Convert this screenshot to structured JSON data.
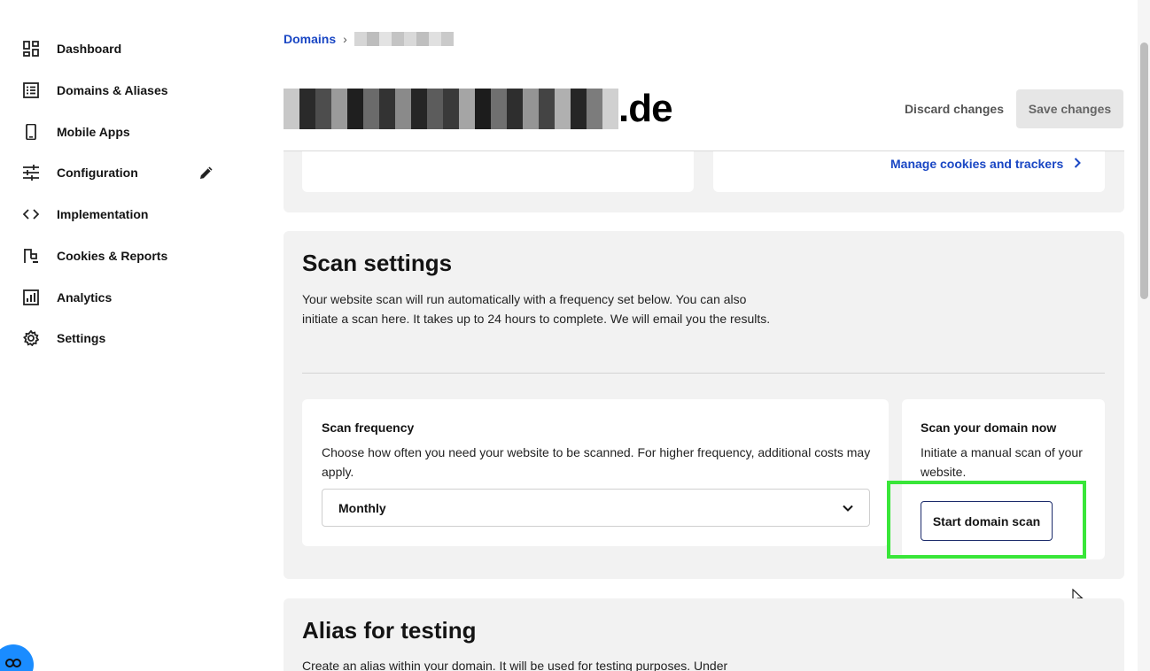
{
  "sidebar": {
    "items": [
      {
        "label": "Dashboard",
        "icon": "dashboard-icon"
      },
      {
        "label": "Domains & Aliases",
        "icon": "list-icon"
      },
      {
        "label": "Mobile Apps",
        "icon": "mobile-icon"
      },
      {
        "label": "Configuration",
        "icon": "sliders-icon"
      },
      {
        "label": "Implementation",
        "icon": "code-icon"
      },
      {
        "label": "Cookies & Reports",
        "icon": "flag-icon"
      },
      {
        "label": "Analytics",
        "icon": "chart-icon"
      },
      {
        "label": "Settings",
        "icon": "gear-icon"
      }
    ]
  },
  "breadcrumb": {
    "root": "Domains",
    "separator": "›"
  },
  "header": {
    "domain_suffix": ".de",
    "discard_label": "Discard changes",
    "save_label": "Save changes"
  },
  "cookies_section": {
    "manage_link": "Manage cookies and trackers"
  },
  "scan_settings": {
    "title": "Scan settings",
    "description": "Your website scan will run automatically with a frequency set below. You can also initiate a scan here. It takes up to 24 hours to complete. We will email you the results.",
    "frequency": {
      "title": "Scan frequency",
      "description": "Choose how often you need your website to be scanned. For higher frequency, additional costs may apply.",
      "selected": "Monthly"
    },
    "scan_now": {
      "title": "Scan your domain now",
      "description": "Initiate a manual scan of your website.",
      "button_label": "Start domain scan"
    }
  },
  "alias_section": {
    "title": "Alias for testing",
    "description": "Create an alias within your domain. It will be used for testing purposes. Under"
  },
  "colors": {
    "link": "#1a47c4",
    "highlight": "#39e639",
    "section_bg": "#f2f2f2",
    "chat": "#1a8cff"
  }
}
